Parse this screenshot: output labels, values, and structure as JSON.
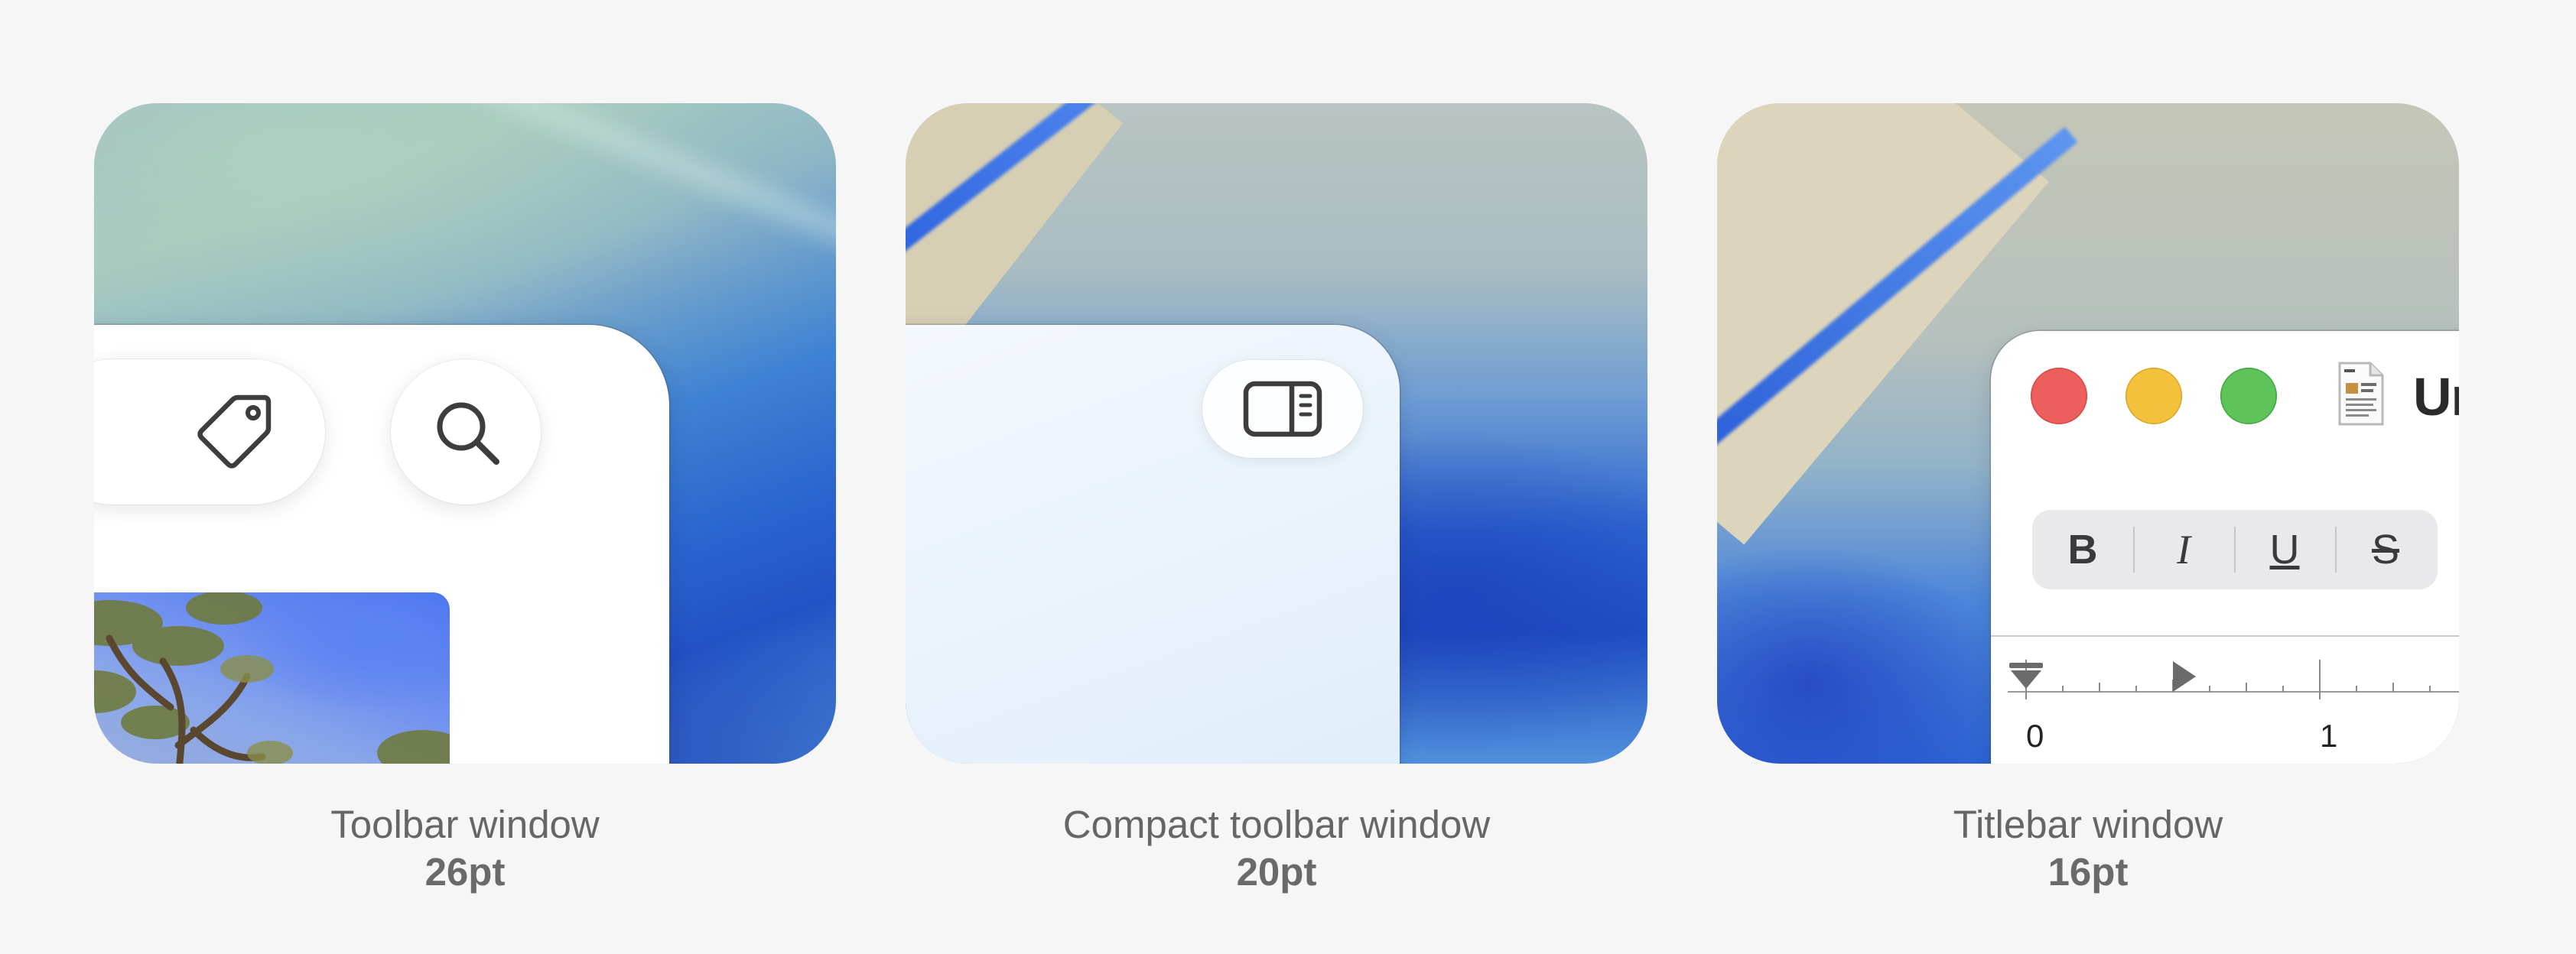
{
  "panels": [
    {
      "caption": "Toolbar window",
      "radius": "26pt"
    },
    {
      "caption": "Compact toolbar window",
      "radius": "20pt"
    },
    {
      "caption": "Titlebar window",
      "radius": "16pt"
    }
  ],
  "titlebar_window": {
    "doc_title": "Un",
    "format_buttons": [
      "B",
      "I",
      "U",
      "S"
    ],
    "ruler_labels": [
      "0",
      "1"
    ]
  },
  "icons": {
    "toolbar": [
      "trash-icon",
      "tag-icon",
      "search-icon"
    ],
    "compact_toolbar": [
      "sidebar-toggle-icon"
    ],
    "titlebar": [
      "close-button",
      "minimize-button",
      "zoom-button",
      "document-icon"
    ]
  },
  "colors": {
    "background": "#f6f6f6",
    "close": "#ec5f5c",
    "minimize": "#f4c13c",
    "zoom": "#5ec45a",
    "caption_text": "#666666"
  }
}
